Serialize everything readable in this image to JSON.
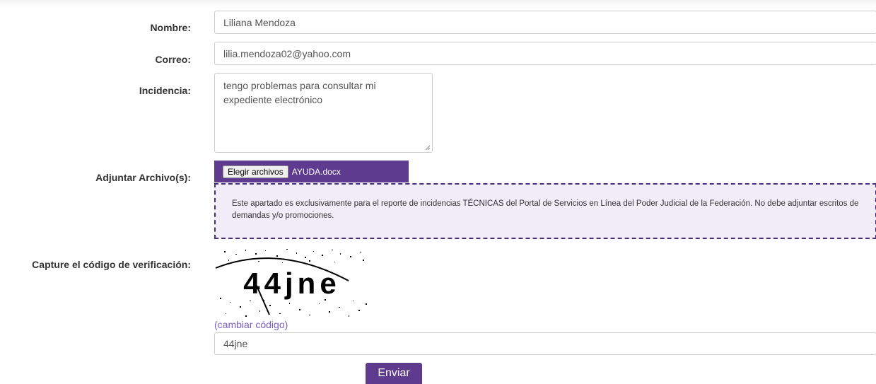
{
  "form": {
    "nombre": {
      "label": "Nombre:",
      "value": "Liliana Mendoza"
    },
    "correo": {
      "label": "Correo:",
      "value": "lilia.mendoza02@yahoo.com"
    },
    "incidencia": {
      "label": "Incidencia:",
      "value": "tengo problemas para consultar mi expediente electrónico"
    },
    "adjuntar": {
      "label": "Adjuntar Archivo(s):",
      "button_label": "Elegir archivos",
      "file_name": "AYUDA.docx",
      "notice": "Este apartado es exclusivamente para el reporte de incidencias TÉCNICAS del Portal de Servicios en Línea del Poder Judicial de la Federación. No debe adjuntar escritos de demandas y/o promociones."
    },
    "captcha": {
      "label": "Capture el código de verificación:",
      "image_text": "44jne",
      "change_link": "(cambiar código)",
      "value": "44jne"
    },
    "submit_label": "Enviar"
  },
  "colors": {
    "accent": "#5f3b8f",
    "notice_border": "#4a2d7a",
    "notice_bg": "#f1eefa",
    "link": "#7b5fc7"
  }
}
